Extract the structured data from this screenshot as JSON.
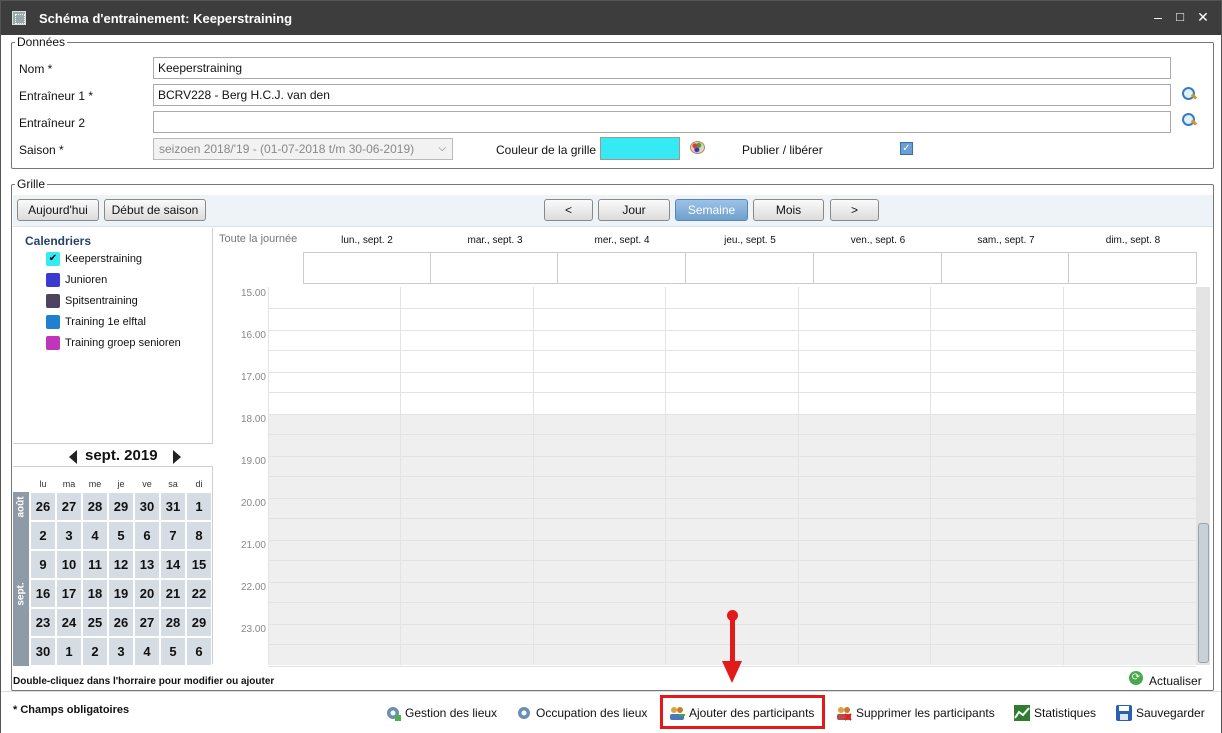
{
  "window": {
    "title": "Schéma d'entrainement: Keeperstraining"
  },
  "data_section": {
    "legend": "Données",
    "name_label": "Nom *",
    "name_value": "Keeperstraining",
    "coach1_label": "Entraîneur 1 *",
    "coach1_value": "BCRV228 - Berg H.C.J. van den",
    "coach2_label": "Entraîneur 2",
    "coach2_value": "",
    "season_label": "Saison *",
    "season_value": "seizoen 2018/'19 - (01-07-2018 t/m 30-06-2019)",
    "grid_color_label": "Couleur de la grille",
    "grid_color": "#35eaf2",
    "publish_label": "Publier / libérer",
    "publish_checked": true
  },
  "grid_section": {
    "legend": "Grille",
    "today_btn": "Aujourd'hui",
    "season_start_btn": "Début de saison",
    "prev_btn": "<",
    "next_btn": ">",
    "view_buttons": [
      "Jour",
      "Semaine",
      "Mois"
    ],
    "active_view": "Semaine",
    "all_day_label": "Toute la journée",
    "columns": [
      "lun., sept. 2",
      "mar., sept. 3",
      "mer., sept. 4",
      "jeu., sept. 5",
      "ven., sept. 6",
      "sam., sept. 7",
      "dim., sept. 8"
    ],
    "hours": [
      "15.00",
      "16.00",
      "17.00",
      "18.00",
      "19.00",
      "20.00",
      "21.00",
      "22.00",
      "23.00"
    ]
  },
  "calendars": {
    "title": "Calendriers",
    "items": [
      {
        "label": "Keeperstraining",
        "color": "#35eaf2",
        "checked": true
      },
      {
        "label": "Junioren",
        "color": "#3a3ad0",
        "checked": false
      },
      {
        "label": "Spitsentraining",
        "color": "#4d4560",
        "checked": false
      },
      {
        "label": "Training 1e elftal",
        "color": "#1f7fd0",
        "checked": false
      },
      {
        "label": "Training groep senioren",
        "color": "#c036b8",
        "checked": false
      }
    ]
  },
  "mini_calendar": {
    "month": "sept. 2019",
    "weekdays": [
      "lu",
      "ma",
      "me",
      "je",
      "ve",
      "sa",
      "di"
    ],
    "side_labels": [
      "août",
      "sept."
    ],
    "weeks": [
      [
        "26",
        "27",
        "28",
        "29",
        "30",
        "31",
        "1"
      ],
      [
        "2",
        "3",
        "4",
        "5",
        "6",
        "7",
        "8"
      ],
      [
        "9",
        "10",
        "11",
        "12",
        "13",
        "14",
        "15"
      ],
      [
        "16",
        "17",
        "18",
        "19",
        "20",
        "21",
        "22"
      ],
      [
        "23",
        "24",
        "25",
        "26",
        "27",
        "28",
        "29"
      ],
      [
        "30",
        "1",
        "2",
        "3",
        "4",
        "5",
        "6"
      ]
    ]
  },
  "footer": {
    "hint": "Double-cliquez dans l'horraire pour modifier ou ajouter",
    "refresh": "Actualiser",
    "required_note": "* Champs obligatoires",
    "actions": [
      "Gestion des lieux",
      "Occupation des lieux",
      "Ajouter des participants",
      "Supprimer les participants",
      "Statistiques",
      "Sauvegarder"
    ]
  }
}
